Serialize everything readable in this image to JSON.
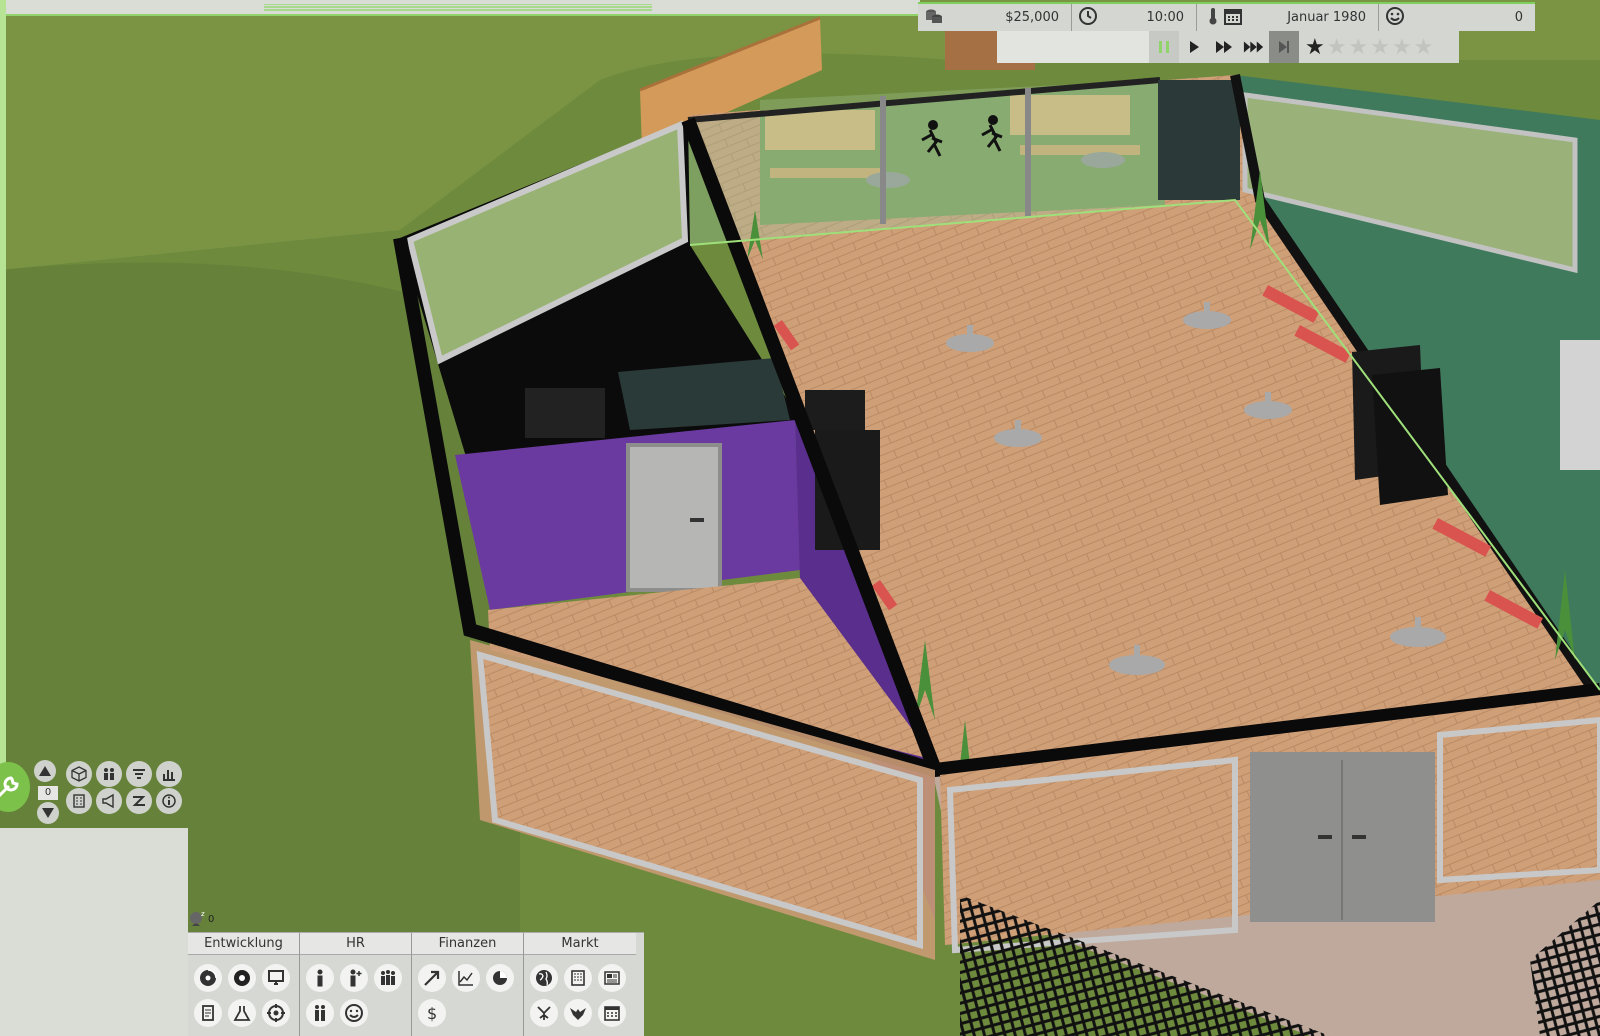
{
  "status": {
    "money": "$25,000",
    "time": "10:00",
    "date": "Januar 1980",
    "happiness": "0"
  },
  "speed": {
    "rating_stars_on": 1,
    "rating_stars_total": 6,
    "buttons": [
      "pause-icon",
      "play-icon",
      "fast-forward-icon",
      "fastest-forward-icon",
      "skip-icon"
    ]
  },
  "tools": {
    "floor_level": "0"
  },
  "staff": {
    "idle_count": "0"
  },
  "menu": {
    "groups": [
      {
        "title": "Entwicklung",
        "icons": [
          "disc-icon",
          "disc-design-icon",
          "computer-icon",
          "document-icon",
          "lab-flask-icon",
          "target-icon"
        ]
      },
      {
        "title": "HR",
        "icons": [
          "person-icon",
          "hire-person-icon",
          "team-icon",
          "staff-pair-icon",
          "smiley-icon"
        ]
      },
      {
        "title": "Finanzen",
        "icons": [
          "trend-up-icon",
          "line-chart-icon",
          "pie-chart-icon",
          "dollar-icon"
        ]
      },
      {
        "title": "Markt",
        "icons": [
          "world-icon",
          "building-icon",
          "newspaper-icon",
          "award-icon",
          "eagle-icon",
          "calendar-icon"
        ]
      }
    ]
  },
  "colors": {
    "accent": "#7cc24a",
    "grass": "#6e8a3e",
    "floor": "#c99a74",
    "purple_wall": "#6a3a9a",
    "panel": "#d6d8d4"
  }
}
